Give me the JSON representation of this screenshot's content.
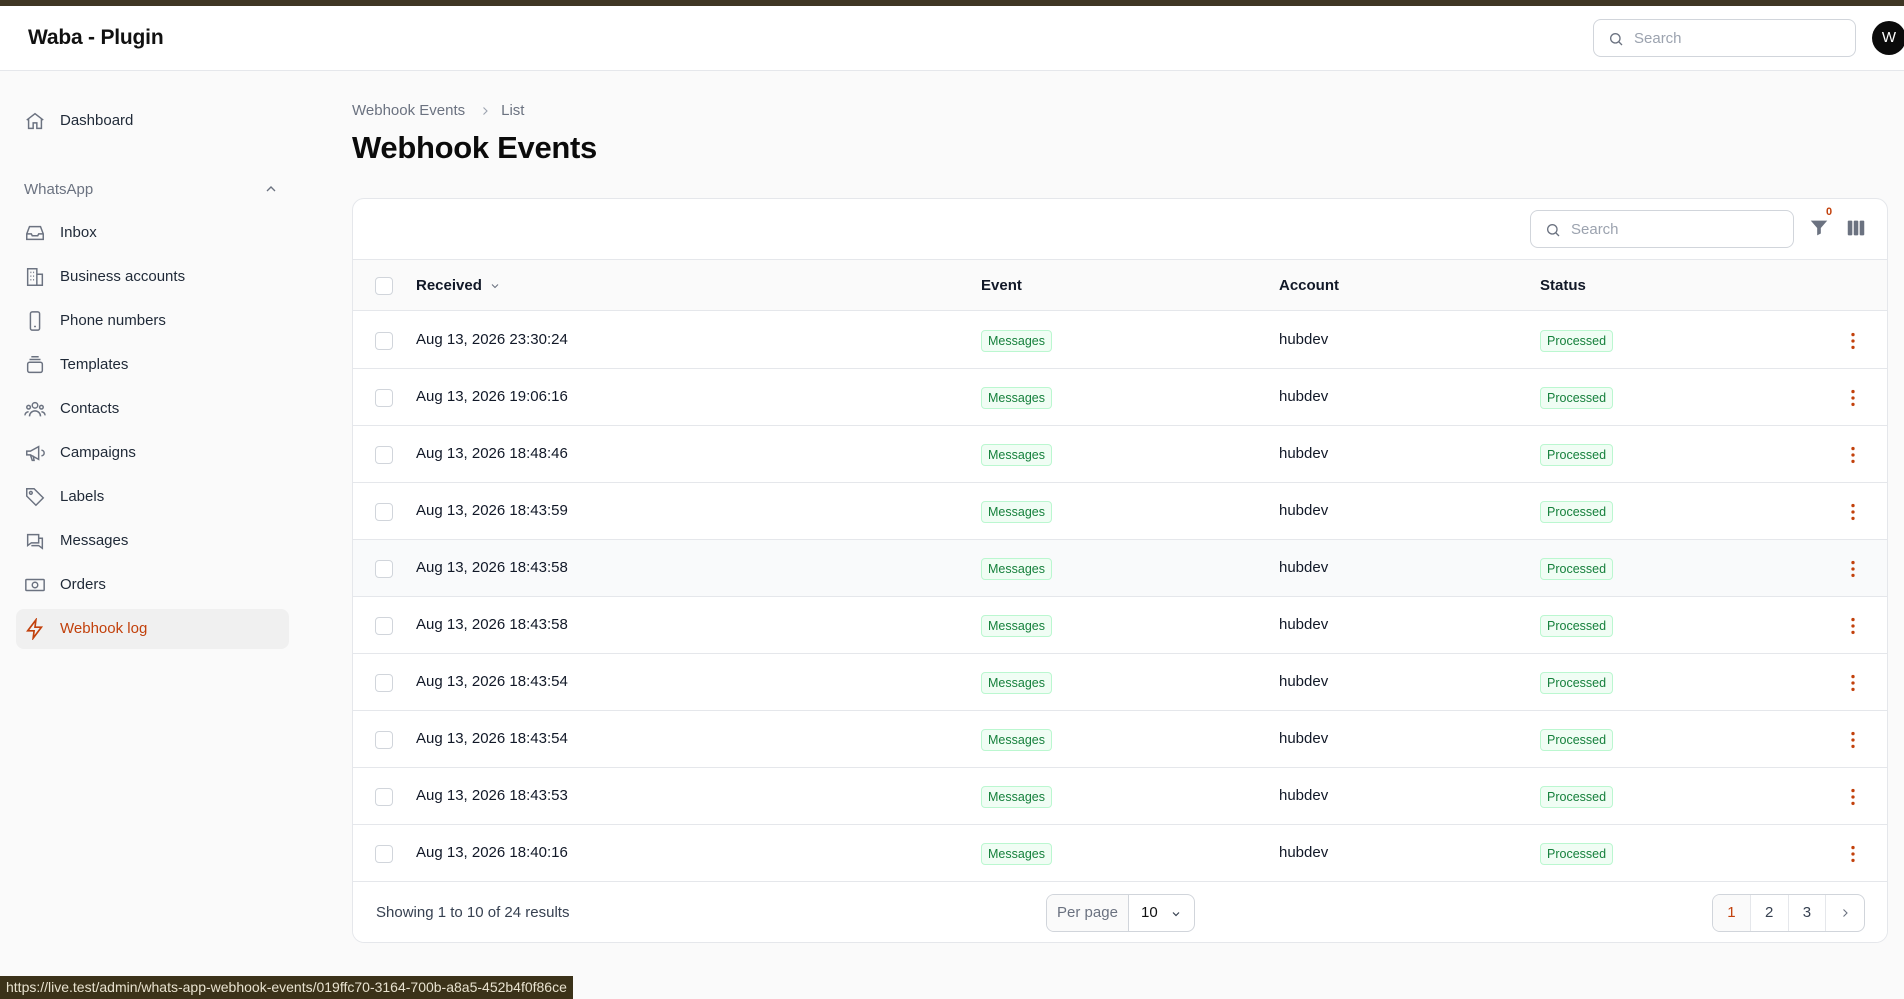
{
  "app": {
    "title": "Waba - Plugin",
    "avatar_initial": "W"
  },
  "topbar": {
    "search_placeholder": "Search"
  },
  "sidebar": {
    "dashboard": "Dashboard",
    "group_label": "WhatsApp",
    "items": [
      {
        "label": "Inbox",
        "icon": "inbox-icon"
      },
      {
        "label": "Business accounts",
        "icon": "building-icon"
      },
      {
        "label": "Phone numbers",
        "icon": "phone-icon"
      },
      {
        "label": "Templates",
        "icon": "stack-icon"
      },
      {
        "label": "Contacts",
        "icon": "users-icon"
      },
      {
        "label": "Campaigns",
        "icon": "megaphone-icon"
      },
      {
        "label": "Labels",
        "icon": "tag-icon"
      },
      {
        "label": "Messages",
        "icon": "chat-icon"
      },
      {
        "label": "Orders",
        "icon": "banknote-icon"
      },
      {
        "label": "Webhook log",
        "icon": "bolt-icon"
      }
    ],
    "active": "Webhook log",
    "accent_color": "#c2410c"
  },
  "breadcrumb": {
    "parent": "Webhook Events",
    "current": "List"
  },
  "page": {
    "title": "Webhook Events"
  },
  "table": {
    "search_placeholder": "Search",
    "filter_count": "0",
    "columns": {
      "received": "Received",
      "event": "Event",
      "account": "Account",
      "status": "Status"
    },
    "rows": [
      {
        "received": "Aug 13, 2026 23:30:24",
        "event": "Messages",
        "account": "hubdev",
        "status": "Processed"
      },
      {
        "received": "Aug 13, 2026 19:06:16",
        "event": "Messages",
        "account": "hubdev",
        "status": "Processed"
      },
      {
        "received": "Aug 13, 2026 18:48:46",
        "event": "Messages",
        "account": "hubdev",
        "status": "Processed"
      },
      {
        "received": "Aug 13, 2026 18:43:59",
        "event": "Messages",
        "account": "hubdev",
        "status": "Processed"
      },
      {
        "received": "Aug 13, 2026 18:43:58",
        "event": "Messages",
        "account": "hubdev",
        "status": "Processed"
      },
      {
        "received": "Aug 13, 2026 18:43:58",
        "event": "Messages",
        "account": "hubdev",
        "status": "Processed"
      },
      {
        "received": "Aug 13, 2026 18:43:54",
        "event": "Messages",
        "account": "hubdev",
        "status": "Processed"
      },
      {
        "received": "Aug 13, 2026 18:43:54",
        "event": "Messages",
        "account": "hubdev",
        "status": "Processed"
      },
      {
        "received": "Aug 13, 2026 18:43:53",
        "event": "Messages",
        "account": "hubdev",
        "status": "Processed"
      },
      {
        "received": "Aug 13, 2026 18:40:16",
        "event": "Messages",
        "account": "hubdev",
        "status": "Processed"
      }
    ],
    "showing": "Showing 1 to 10 of 24 results",
    "per_page_label": "Per page",
    "per_page_value": "10",
    "pages": [
      "1",
      "2",
      "3"
    ],
    "current_page": "1"
  },
  "status_bar": {
    "url": "https://live.test/admin/whats-app-webhook-events/019ffc70-3164-700b-a8a5-452b4f0f86ce"
  }
}
